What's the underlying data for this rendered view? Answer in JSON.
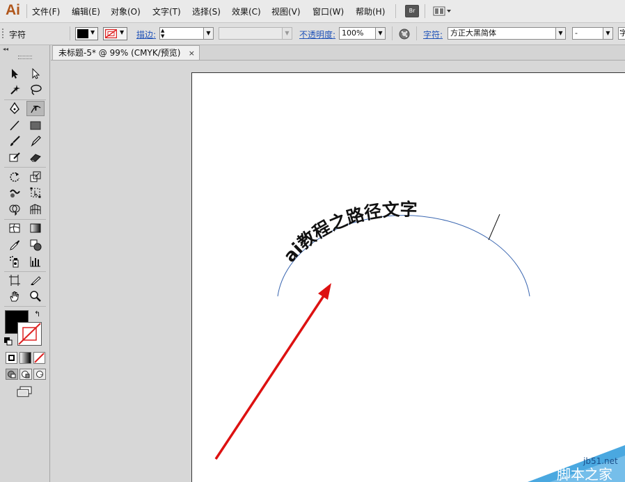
{
  "app": {
    "logo": "Ai",
    "accent": "#b0561b"
  },
  "menu": {
    "items": [
      "文件(F)",
      "编辑(E)",
      "对象(O)",
      "文字(T)",
      "选择(S)",
      "效果(C)",
      "视图(V)",
      "窗口(W)",
      "帮助(H)"
    ],
    "bridge_label": "Br"
  },
  "control_bar": {
    "selection_label": "字符",
    "stroke_label": "描边:",
    "opacity_label": "不透明度:",
    "opacity_value": "100%",
    "character_label": "字符:",
    "font_value": "方正大黑简体",
    "style_value": "-",
    "edge_glyph": "字"
  },
  "document": {
    "tab_title": "未标题-5* @ 99% (CMYK/预览)",
    "tab_close": "×"
  },
  "canvas": {
    "path_text": "ai教程之路径文字",
    "path_color": "#3a66b0",
    "arrow_color": "#dd1111"
  },
  "watermark": {
    "site": "jb51.net",
    "name": "脚本之家"
  },
  "icons": [
    "selection-tool-icon",
    "direct-selection-tool-icon",
    "magic-wand-tool-icon",
    "lasso-tool-icon",
    "pen-tool-icon",
    "type-on-path-tool-icon",
    "line-tool-icon",
    "rectangle-tool-icon",
    "paintbrush-tool-icon",
    "pencil-tool-icon",
    "blob-brush-tool-icon",
    "eraser-tool-icon",
    "rotate-tool-icon",
    "scale-tool-icon",
    "warp-tool-icon",
    "free-transform-tool-icon",
    "shape-builder-tool-icon",
    "perspective-grid-tool-icon",
    "mesh-tool-icon",
    "gradient-tool-icon",
    "eyedropper-tool-icon",
    "blend-tool-icon",
    "symbol-sprayer-tool-icon",
    "column-graph-tool-icon",
    "artboard-tool-icon",
    "slice-tool-icon",
    "hand-tool-icon",
    "zoom-tool-icon"
  ]
}
